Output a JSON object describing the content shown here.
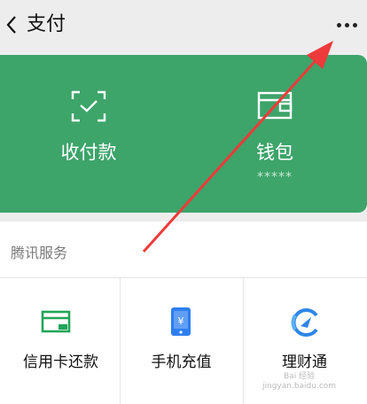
{
  "header": {
    "title": "支付"
  },
  "wallet_panel": {
    "items": [
      {
        "label": "收付款",
        "icon": "scan-pay-icon"
      },
      {
        "label": "钱包",
        "sub": "*****",
        "icon": "wallet-icon"
      }
    ],
    "color": "#3da46a"
  },
  "tencent_services": {
    "title": "腾讯服务",
    "items": [
      {
        "label": "信用卡还款",
        "icon": "credit-card-icon",
        "color": "#22a55a"
      },
      {
        "label": "手机充值",
        "icon": "phone-recharge-icon",
        "color": "#2d7ff0"
      },
      {
        "label": "理财通",
        "icon": "wealth-icon",
        "color": "#2f86e8"
      }
    ]
  },
  "annotation": {
    "color": "#ee3a3a"
  },
  "watermark": {
    "line1": "Bai 经验",
    "line2": "jingyan.baidu.com"
  }
}
